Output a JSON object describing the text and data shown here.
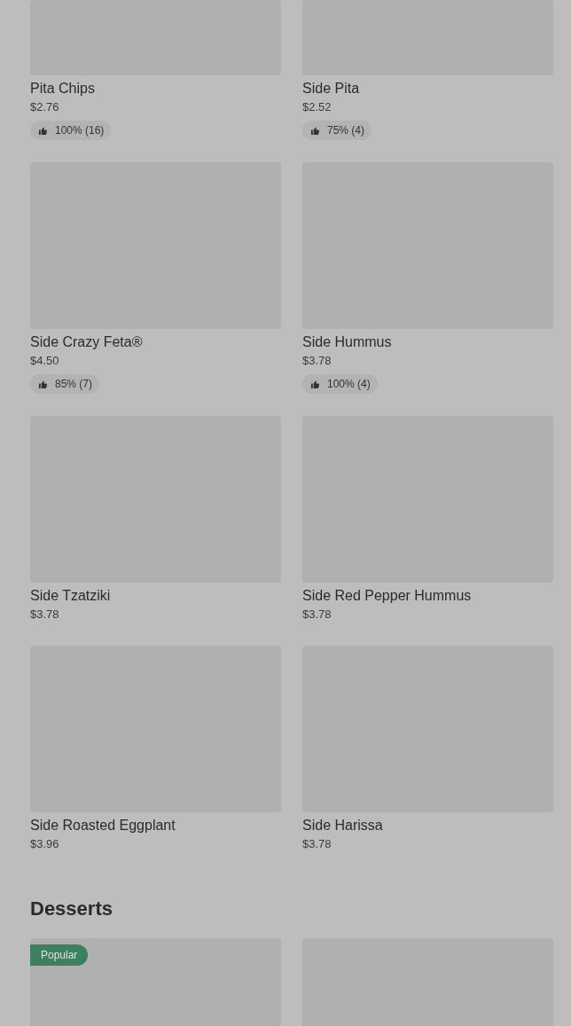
{
  "items": [
    {
      "name": "Pita Chips",
      "price": "$2.76",
      "rating": "100% (16)"
    },
    {
      "name": "Side Pita",
      "price": "$2.52",
      "rating": "75% (4)"
    },
    {
      "name": "Side Crazy Feta®",
      "price": "$4.50",
      "rating": "85% (7)"
    },
    {
      "name": "Side Hummus",
      "price": "$3.78",
      "rating": "100% (4)"
    },
    {
      "name": "Side Tzatziki",
      "price": "$3.78"
    },
    {
      "name": "Side Red Pepper Hummus",
      "price": "$3.78"
    },
    {
      "name": "Side Roasted Eggplant",
      "price": "$3.96"
    },
    {
      "name": "Side Harissa",
      "price": "$3.78"
    }
  ],
  "desserts": {
    "title": "Desserts",
    "items": [
      {
        "kind": "picture",
        "badge": "Popular"
      },
      {
        "kind": "picture"
      }
    ]
  }
}
